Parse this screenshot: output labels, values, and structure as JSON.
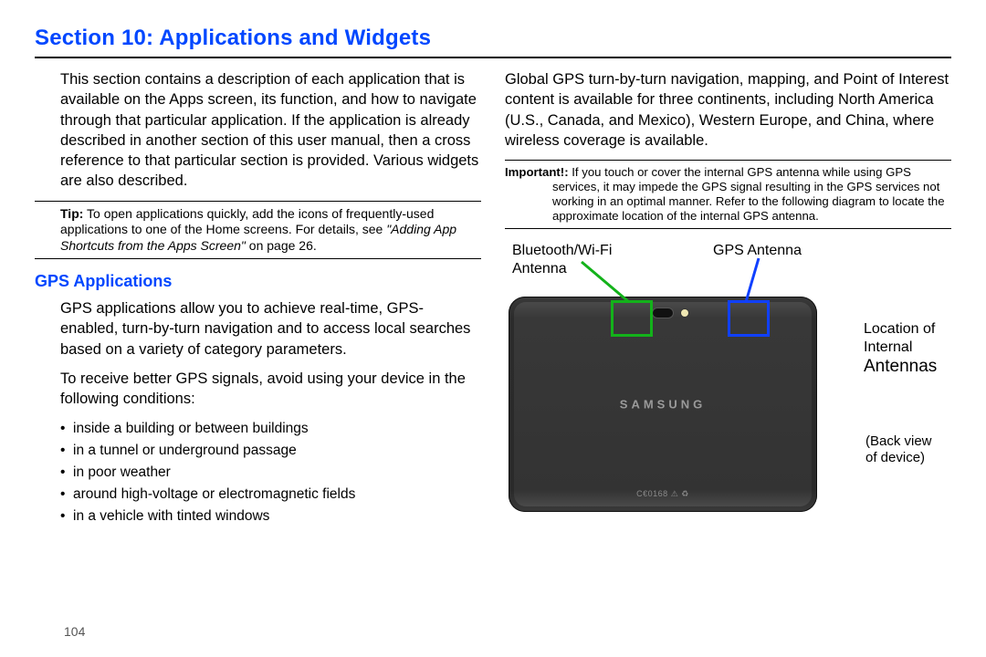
{
  "page": {
    "section_title": "Section 10:  Applications and Widgets",
    "page_number": "104"
  },
  "left": {
    "intro": "This section contains a description of each application that is available on the Apps screen, its function, and how to navigate through that particular application. If the application is already described in another section of this user manual, then a cross reference to that particular section is provided. Various widgets are also described.",
    "tip_label": "Tip:",
    "tip_body_plain": " To open applications quickly, add the icons of frequently-used applications to one of the Home screens. For details, see ",
    "tip_body_ital": "\"Adding App Shortcuts from the Apps Screen\"",
    "tip_body_tail": " on page 26.",
    "subhead": "GPS Applications",
    "p1": "GPS applications allow you to achieve real-time, GPS-enabled, turn-by-turn navigation and to access local searches based on a variety of category parameters.",
    "p2": "To receive better GPS signals, avoid using your device in the following conditions:",
    "bullets": [
      " inside a building or between buildings",
      "in a tunnel or underground passage",
      "in poor weather",
      "around high-voltage or electromagnetic fields",
      "in a vehicle with tinted windows"
    ]
  },
  "right": {
    "p1": "Global GPS turn-by-turn navigation, mapping, and Point of Interest content is available for three continents, including North America (U.S., Canada, and Mexico), Western Europe, and China, where wireless coverage is available.",
    "important_label": "Important!:",
    "important_body": " If you touch or cover the internal GPS antenna while using GPS services, it may impede the GPS signal resulting in the GPS services not working in an optimal manner. Refer to the following diagram to locate the approximate location of the internal GPS antenna.",
    "diagram": {
      "bt_label_line1": "Bluetooth/Wi-Fi",
      "bt_label_line2": "Antenna",
      "gps_label": "GPS Antenna",
      "side_line1": "Location of",
      "side_line2": "Internal",
      "side_line3": "Antennas",
      "back_view_line1": "(Back view",
      "back_view_line2": " of device)",
      "brand": "SAMSUNG",
      "ce_mark": "C€0168 ⚠ ♻"
    }
  },
  "colors": {
    "heading_blue": "#0047ff",
    "antenna_green": "#13b21a",
    "antenna_blue": "#1040ff"
  }
}
